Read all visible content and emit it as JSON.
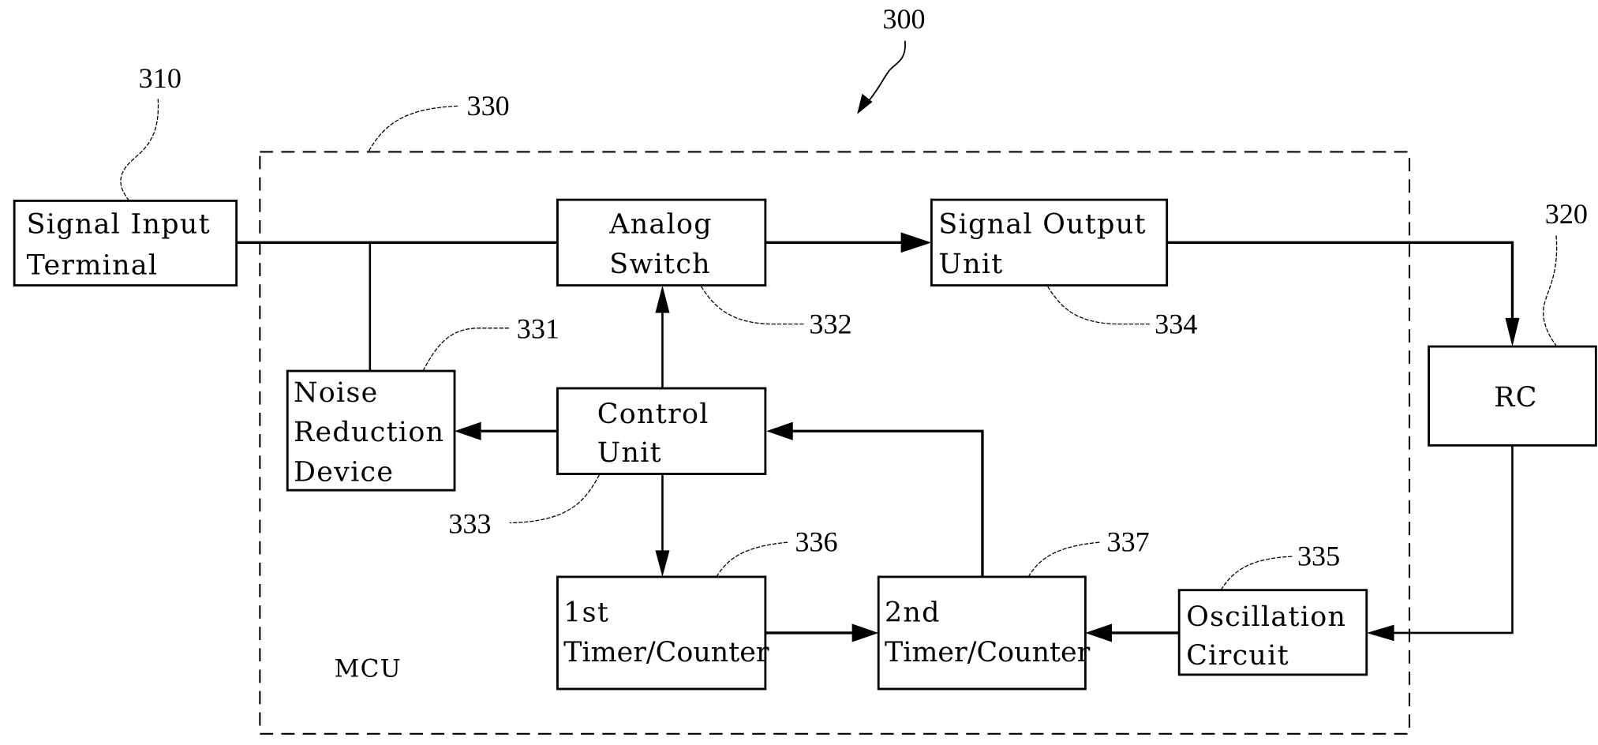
{
  "figure": {
    "number": "300",
    "mcu_label": "MCU",
    "mcu_ref": "330"
  },
  "blocks": {
    "signal_input": {
      "lines": [
        "Signal Input",
        "Terminal"
      ],
      "ref": "310"
    },
    "rc": {
      "lines": [
        "RC"
      ],
      "ref": "320"
    },
    "noise_reduction": {
      "lines": [
        "Noise",
        "Reduction",
        "Device"
      ],
      "ref": "331"
    },
    "analog_switch": {
      "lines": [
        "Analog",
        "Switch"
      ],
      "ref": "332"
    },
    "control_unit": {
      "lines": [
        "Control",
        "Unit"
      ],
      "ref": "333"
    },
    "signal_output": {
      "lines": [
        "Signal Output",
        "Unit"
      ],
      "ref": "334"
    },
    "oscillation": {
      "lines": [
        "Oscillation",
        "Circuit"
      ],
      "ref": "335"
    },
    "timer1": {
      "lines": [
        "1st",
        "Timer/Counter"
      ],
      "ref": "336"
    },
    "timer2": {
      "lines": [
        "2nd",
        "Timer/Counter"
      ],
      "ref": "337"
    }
  },
  "connections": [
    {
      "from": "Signal Input Terminal",
      "to": "Analog Switch"
    },
    {
      "from": "Signal Input Terminal",
      "to": "Noise Reduction Device"
    },
    {
      "from": "Analog Switch",
      "to": "Signal Output Unit"
    },
    {
      "from": "Signal Output Unit",
      "to": "RC"
    },
    {
      "from": "RC",
      "to": "Oscillation Circuit"
    },
    {
      "from": "Oscillation Circuit",
      "to": "2nd Timer/Counter"
    },
    {
      "from": "1st Timer/Counter",
      "to": "2nd Timer/Counter"
    },
    {
      "from": "2nd Timer/Counter",
      "to": "Control Unit"
    },
    {
      "from": "Control Unit",
      "to": "Analog Switch"
    },
    {
      "from": "Control Unit",
      "to": "Noise Reduction Device"
    },
    {
      "from": "Control Unit",
      "to": "1st Timer/Counter"
    }
  ]
}
